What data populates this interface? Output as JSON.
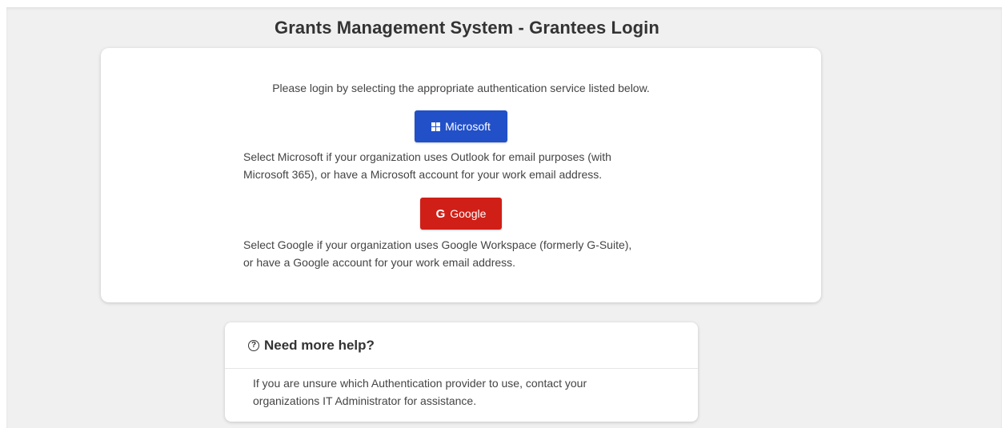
{
  "page": {
    "title": "Grants Management System - Grantees Login"
  },
  "login": {
    "intro": "Please login by selecting the appropriate authentication service listed below.",
    "microsoft": {
      "label": "Microsoft",
      "icon": "microsoft-logo-icon",
      "color": "#2250c8",
      "description_line1": "Select Microsoft if your organization uses Outlook for email purposes (with",
      "description_line2": "Microsoft 365), or have a Microsoft account for your work email address."
    },
    "google": {
      "label": "Google",
      "icon_glyph": "G",
      "icon": "google-logo-icon",
      "color": "#d01f17",
      "description_line1": "Select Google if your organization uses Google Workspace (formerly G-Suite),",
      "description_line2": "or have a Google account for your work email address."
    }
  },
  "help": {
    "icon": "question-circle-icon",
    "icon_glyph": "?",
    "title": "Need more help?",
    "body_line1": "If you are unsure which Authentication provider to use, contact your",
    "body_line2": "organizations IT Administrator for assistance."
  }
}
